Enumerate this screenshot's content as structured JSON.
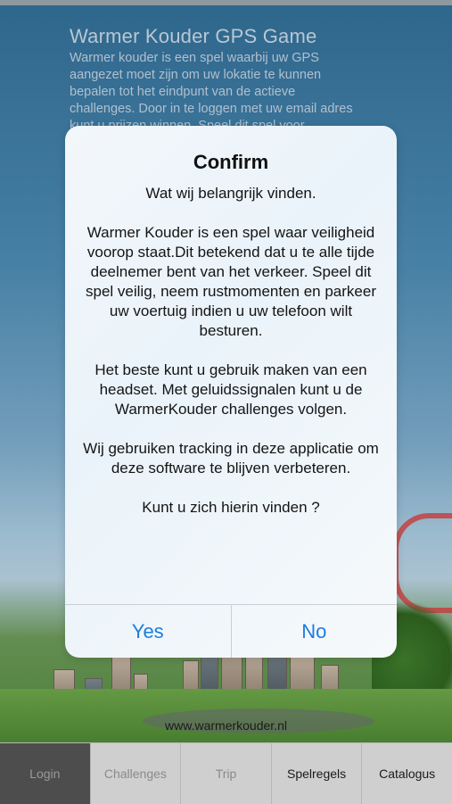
{
  "background": {
    "title": "Warmer Kouder GPS Game",
    "description": "Warmer kouder is een spel waarbij uw GPS aangezet moet zijn om uw lokatie te kunnen bepalen tot het eindpunt van de actieve challenges. Door in te loggen met uw email adres kunt u prijzen winnen. Speel dit spel voor",
    "website": "www.warmerkouder.nl"
  },
  "dialog": {
    "title": "Confirm",
    "paragraphs": [
      "Wat wij belangrijk vinden.",
      "Warmer Kouder is een spel waar veiligheid voorop staat.Dit betekend dat u te alle tijde deelnemer bent van het verkeer. Speel dit spel veilig, neem rustmomenten en parkeer uw voertuig indien u uw telefoon wilt besturen.",
      "Het beste kunt u gebruik maken van een headset. Met geluidssignalen kunt u de WarmerKouder challenges volgen.",
      "Wij gebruiken tracking in deze applicatie om deze software te blijven verbeteren.",
      "Kunt u zich hierin vinden ?"
    ],
    "yes_label": "Yes",
    "no_label": "No"
  },
  "tabs": [
    {
      "label": "Login",
      "active": true
    },
    {
      "label": "Challenges",
      "active": false
    },
    {
      "label": "Trip",
      "active": false
    },
    {
      "label": "Spelregels",
      "active": false
    },
    {
      "label": "Catalogus",
      "active": false
    }
  ],
  "colors": {
    "accent": "#1b7de0",
    "tab_active_bg": "#4d4d4d",
    "tabbar_bg": "#cfcfcf"
  }
}
